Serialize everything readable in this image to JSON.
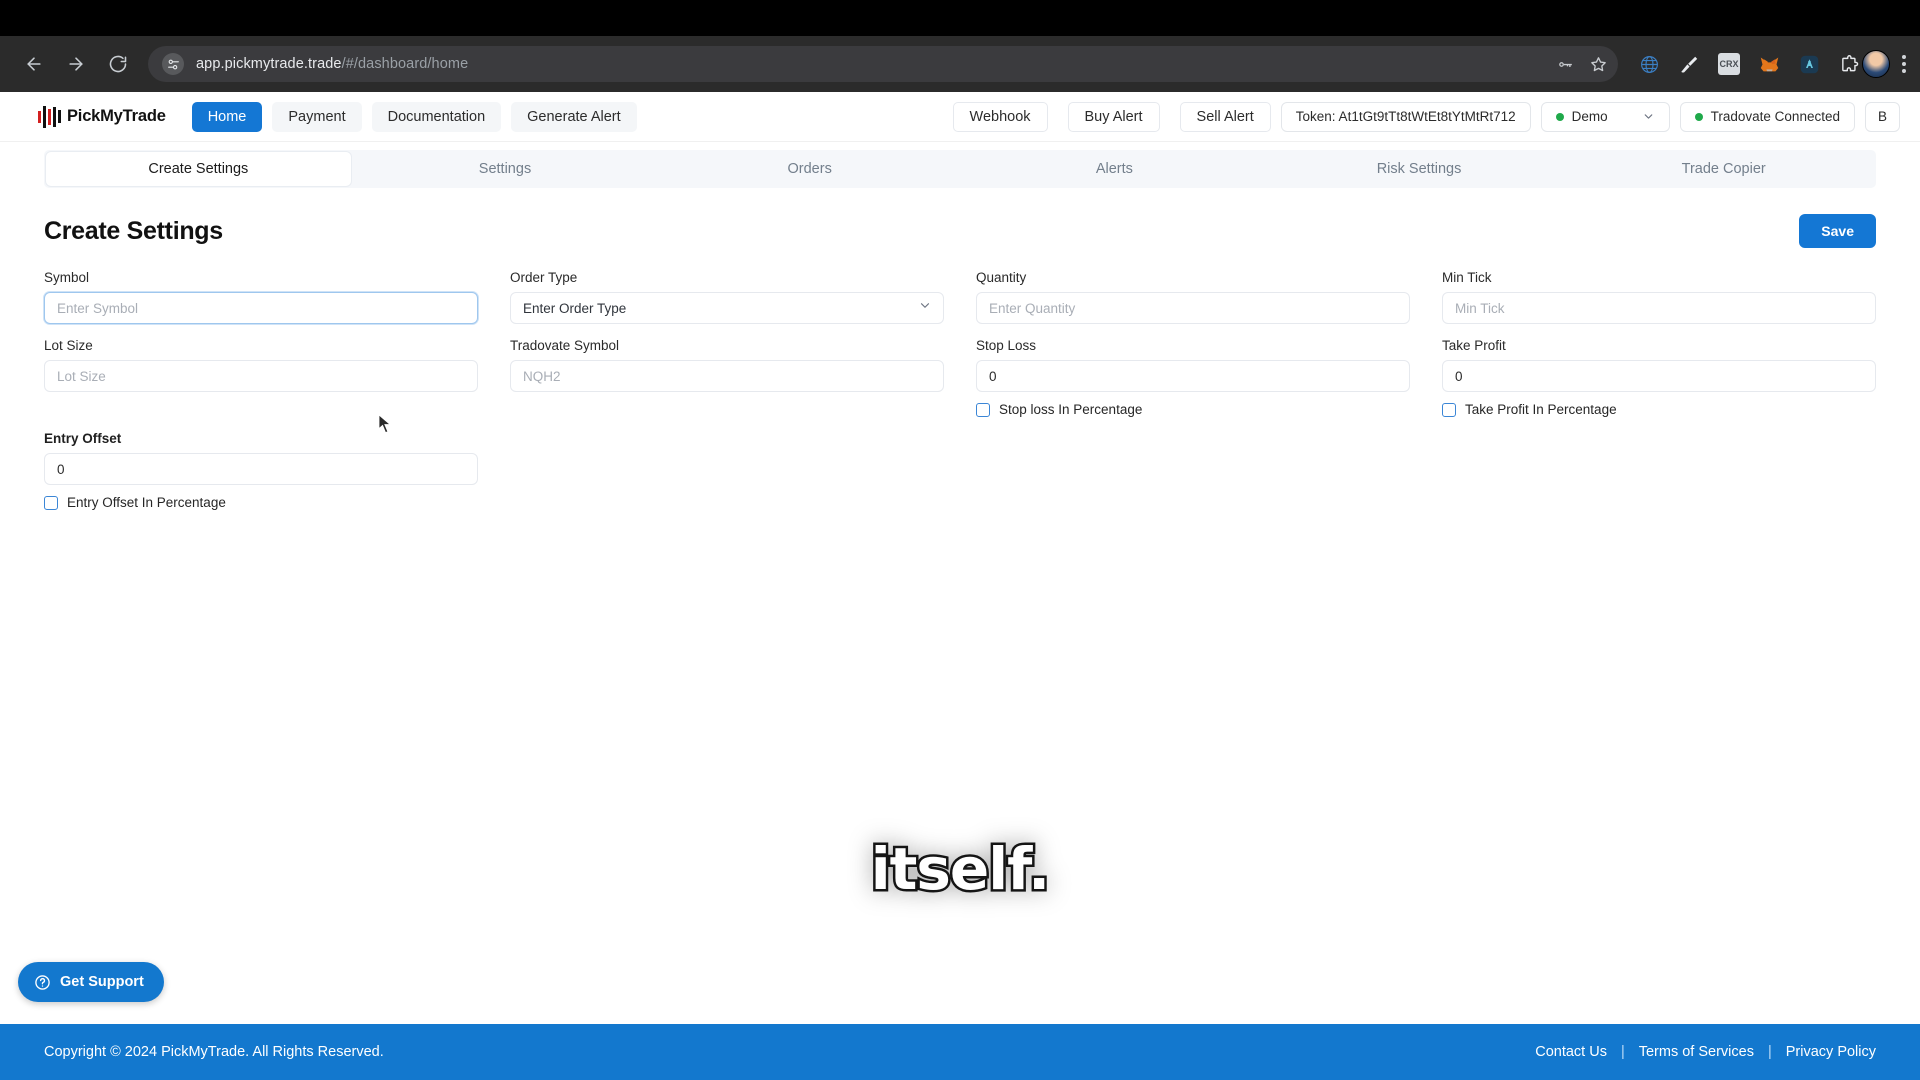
{
  "browser": {
    "url_domain": "app.pickmytrade.trade",
    "url_path": "/#/dashboard/home",
    "icons": {
      "back": "back-arrow-icon",
      "forward": "forward-arrow-icon",
      "reload": "reload-icon",
      "site_settings": "site-settings-icon",
      "password": "password-key-icon",
      "bookmark": "bookmark-star-icon",
      "ext1": "globe-extension-icon",
      "ext2": "broom-extension-icon",
      "ext3": "crx-extension-icon",
      "ext4": "metamask-fox-icon",
      "ext5": "blue-app-extension-icon",
      "ext6": "puzzle-extensions-icon",
      "profile": "profile-avatar",
      "menu": "three-dot-menu-icon"
    },
    "ext3_label": "CRX"
  },
  "header": {
    "logo_text": "PickMyTrade",
    "nav": [
      {
        "label": "Home",
        "active": true
      },
      {
        "label": "Payment",
        "active": false
      },
      {
        "label": "Documentation",
        "active": false
      },
      {
        "label": "Generate Alert",
        "active": false
      }
    ],
    "actions": [
      {
        "label": "Webhook"
      },
      {
        "label": "Buy Alert"
      },
      {
        "label": "Sell Alert"
      }
    ],
    "token": "Token: At1tGt9tTt8tWtEt8tYtMtRt712",
    "account_mode": "Demo",
    "connection_status": "Tradovate Connected",
    "broker_initial": "B",
    "accent_color": "#1477d4",
    "status_dot_color": "#1fa94a"
  },
  "tabs": [
    {
      "label": "Create Settings",
      "active": true
    },
    {
      "label": "Settings",
      "active": false
    },
    {
      "label": "Orders",
      "active": false
    },
    {
      "label": "Alerts",
      "active": false
    },
    {
      "label": "Risk Settings",
      "active": false
    },
    {
      "label": "Trade Copier",
      "active": false
    }
  ],
  "page": {
    "title": "Create Settings",
    "save_label": "Save"
  },
  "form": {
    "fields": [
      {
        "label": "Symbol",
        "placeholder": "Enter Symbol",
        "value": "",
        "type": "text",
        "focused": true
      },
      {
        "label": "Order Type",
        "placeholder": "Enter Order Type",
        "value": "Enter Order Type",
        "type": "select",
        "focused": false
      },
      {
        "label": "Quantity",
        "placeholder": "Enter Quantity",
        "value": "",
        "type": "text",
        "focused": false
      },
      {
        "label": "Min Tick",
        "placeholder": "Min Tick",
        "value": "",
        "type": "text",
        "focused": false
      },
      {
        "label": "Lot Size",
        "placeholder": "Lot Size",
        "value": "",
        "type": "text",
        "focused": false
      },
      {
        "label": "Tradovate Symbol",
        "placeholder": "NQH2",
        "value": "",
        "type": "text",
        "focused": false
      },
      {
        "label": "Stop Loss",
        "placeholder": "0",
        "value": "0",
        "type": "text",
        "focused": false,
        "checkbox": "Stop loss In Percentage",
        "checked": false
      },
      {
        "label": "Take Profit",
        "placeholder": "0",
        "value": "0",
        "type": "text",
        "focused": false,
        "checkbox": "Take Profit In Percentage",
        "checked": false
      },
      {
        "label": "Entry Offset",
        "placeholder": "0",
        "value": "0",
        "type": "text",
        "focused": false,
        "checkbox": "Entry Offset In Percentage",
        "checked": false
      }
    ]
  },
  "watermark": {
    "text": "itself."
  },
  "support": {
    "label": "Get Support",
    "icon": "question-mark-icon"
  },
  "footer": {
    "copyright": "Copyright © 2024 PickMyTrade. All Rights Reserved.",
    "links": [
      {
        "label": "Contact Us"
      },
      {
        "label": "Terms of Services"
      },
      {
        "label": "Privacy Policy"
      }
    ],
    "background_color": "#1378ce"
  }
}
